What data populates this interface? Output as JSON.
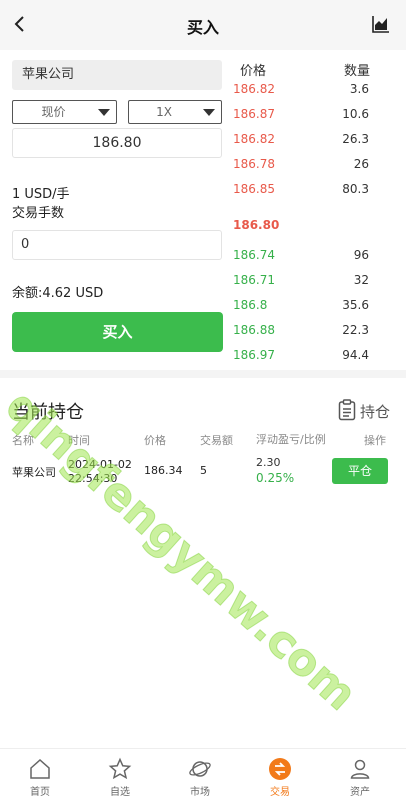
{
  "header": {
    "title": "买入",
    "back_icon": "chevron-left-icon",
    "chart_icon": "area-chart-icon"
  },
  "order": {
    "stock_name": "苹果公司",
    "order_type": "现价",
    "leverage": "1X",
    "price": "186.80",
    "unit": "1 USD/手",
    "qty_label": "交易手数",
    "qty_value": "0",
    "balance": "余额:4.62 USD",
    "buy_label": "买入"
  },
  "book": {
    "price_header": "价格",
    "qty_header": "数量",
    "asks": [
      {
        "price": "186.82",
        "qty": "3.6"
      },
      {
        "price": "186.87",
        "qty": "10.6"
      },
      {
        "price": "186.82",
        "qty": "26.3"
      },
      {
        "price": "186.78",
        "qty": "26"
      },
      {
        "price": "186.85",
        "qty": "80.3"
      }
    ],
    "last_price": "186.80",
    "bids": [
      {
        "price": "186.74",
        "qty": "96"
      },
      {
        "price": "186.71",
        "qty": "32"
      },
      {
        "price": "186.8",
        "qty": "35.6"
      },
      {
        "price": "186.88",
        "qty": "22.3"
      },
      {
        "price": "186.97",
        "qty": "94.4"
      }
    ]
  },
  "positions": {
    "title": "当前持仓",
    "hold_label": "持仓",
    "columns": [
      "名称",
      "时间",
      "价格",
      "交易额",
      "浮动盈亏/比例",
      "操作"
    ],
    "rows": [
      {
        "name": "苹果公司",
        "date": "2024-01-02",
        "time": "22:54:30",
        "price": "186.34",
        "amount": "5",
        "pnl": "2.30",
        "pnl_pct": "0.25%",
        "action": "平仓"
      }
    ]
  },
  "tabs": [
    {
      "label": "首页",
      "icon": "home-icon"
    },
    {
      "label": "自选",
      "icon": "star-icon"
    },
    {
      "label": "市场",
      "icon": "planet-icon"
    },
    {
      "label": "交易",
      "icon": "trade-icon",
      "active": true
    },
    {
      "label": "资产",
      "icon": "user-icon"
    }
  ],
  "watermark": "qingfengymw.com",
  "colors": {
    "up": "#e8594a",
    "down": "#36b04a",
    "accent": "#3cbc4d",
    "active_tab": "#f27a1a"
  }
}
